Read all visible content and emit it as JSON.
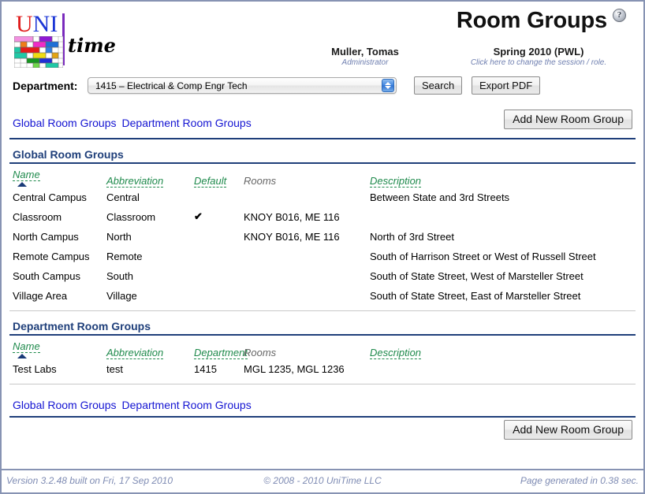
{
  "header": {
    "title": "Room Groups",
    "help_icon": "help-question-icon",
    "logo": {
      "uni_u": "U",
      "uni_n": "NI",
      "time": "time"
    },
    "user_name": "Muller, Tomas",
    "user_role": "Administrator",
    "session_name": "Spring 2010 (PWL)",
    "session_hint": "Click here to change the session / role."
  },
  "toolbar": {
    "department_label": "Department:",
    "department_value": "1415 – Electrical & Comp Engr Tech",
    "search_label": "Search",
    "export_label": "Export PDF"
  },
  "nav": {
    "global_link": "Global Room Groups",
    "department_link": "Department Room Groups",
    "add_button": "Add New Room Group"
  },
  "global_section": {
    "title": "Global Room Groups",
    "columns": [
      {
        "label": "Name",
        "sortable": true,
        "sorted": true
      },
      {
        "label": "Abbreviation",
        "sortable": true,
        "sorted": false
      },
      {
        "label": "Default",
        "sortable": true,
        "sorted": false
      },
      {
        "label": "Rooms",
        "sortable": false,
        "sorted": false
      },
      {
        "label": "Description",
        "sortable": true,
        "sorted": false
      }
    ],
    "rows": [
      {
        "name": "Central Campus",
        "abbreviation": "Central",
        "default": "",
        "rooms": "",
        "description": "Between State and 3rd Streets"
      },
      {
        "name": "Classroom",
        "abbreviation": "Classroom",
        "default": "✔",
        "rooms": "KNOY B016, ME 116",
        "description": ""
      },
      {
        "name": "North Campus",
        "abbreviation": "North",
        "default": "",
        "rooms": "KNOY B016, ME 116",
        "description": "North of 3rd Street"
      },
      {
        "name": "Remote Campus",
        "abbreviation": "Remote",
        "default": "",
        "rooms": "",
        "description": "South of Harrison Street or West of Russell Street"
      },
      {
        "name": "South Campus",
        "abbreviation": "South",
        "default": "",
        "rooms": "",
        "description": "South of State Street, West of Marsteller Street"
      },
      {
        "name": "Village Area",
        "abbreviation": "Village",
        "default": "",
        "rooms": "",
        "description": "South of State Street, East of Marsteller Street"
      }
    ]
  },
  "department_section": {
    "title": "Department Room Groups",
    "columns": [
      {
        "label": "Name",
        "sortable": true,
        "sorted": true
      },
      {
        "label": "Abbreviation",
        "sortable": true,
        "sorted": false
      },
      {
        "label": "Department",
        "sortable": true,
        "sorted": false
      },
      {
        "label": "Rooms",
        "sortable": false,
        "sorted": false
      },
      {
        "label": "Description",
        "sortable": true,
        "sorted": false
      }
    ],
    "rows": [
      {
        "name": "Test Labs",
        "abbreviation": "test",
        "department": "1415",
        "rooms": "MGL 1235, MGL 1236",
        "description": ""
      }
    ]
  },
  "footer": {
    "version": "Version 3.2.48 built on Fri, 17 Sep 2010",
    "copyright": "© 2008 - 2010 UniTime LLC",
    "generated": "Page generated in 0.38 sec."
  },
  "colors": {
    "accent_navy": "#1f3f7a",
    "link_blue": "#1414d2",
    "sortable_green": "#1f8a4c",
    "footer_gray": "#7e8bb3",
    "check_green": "#2e7d20"
  }
}
